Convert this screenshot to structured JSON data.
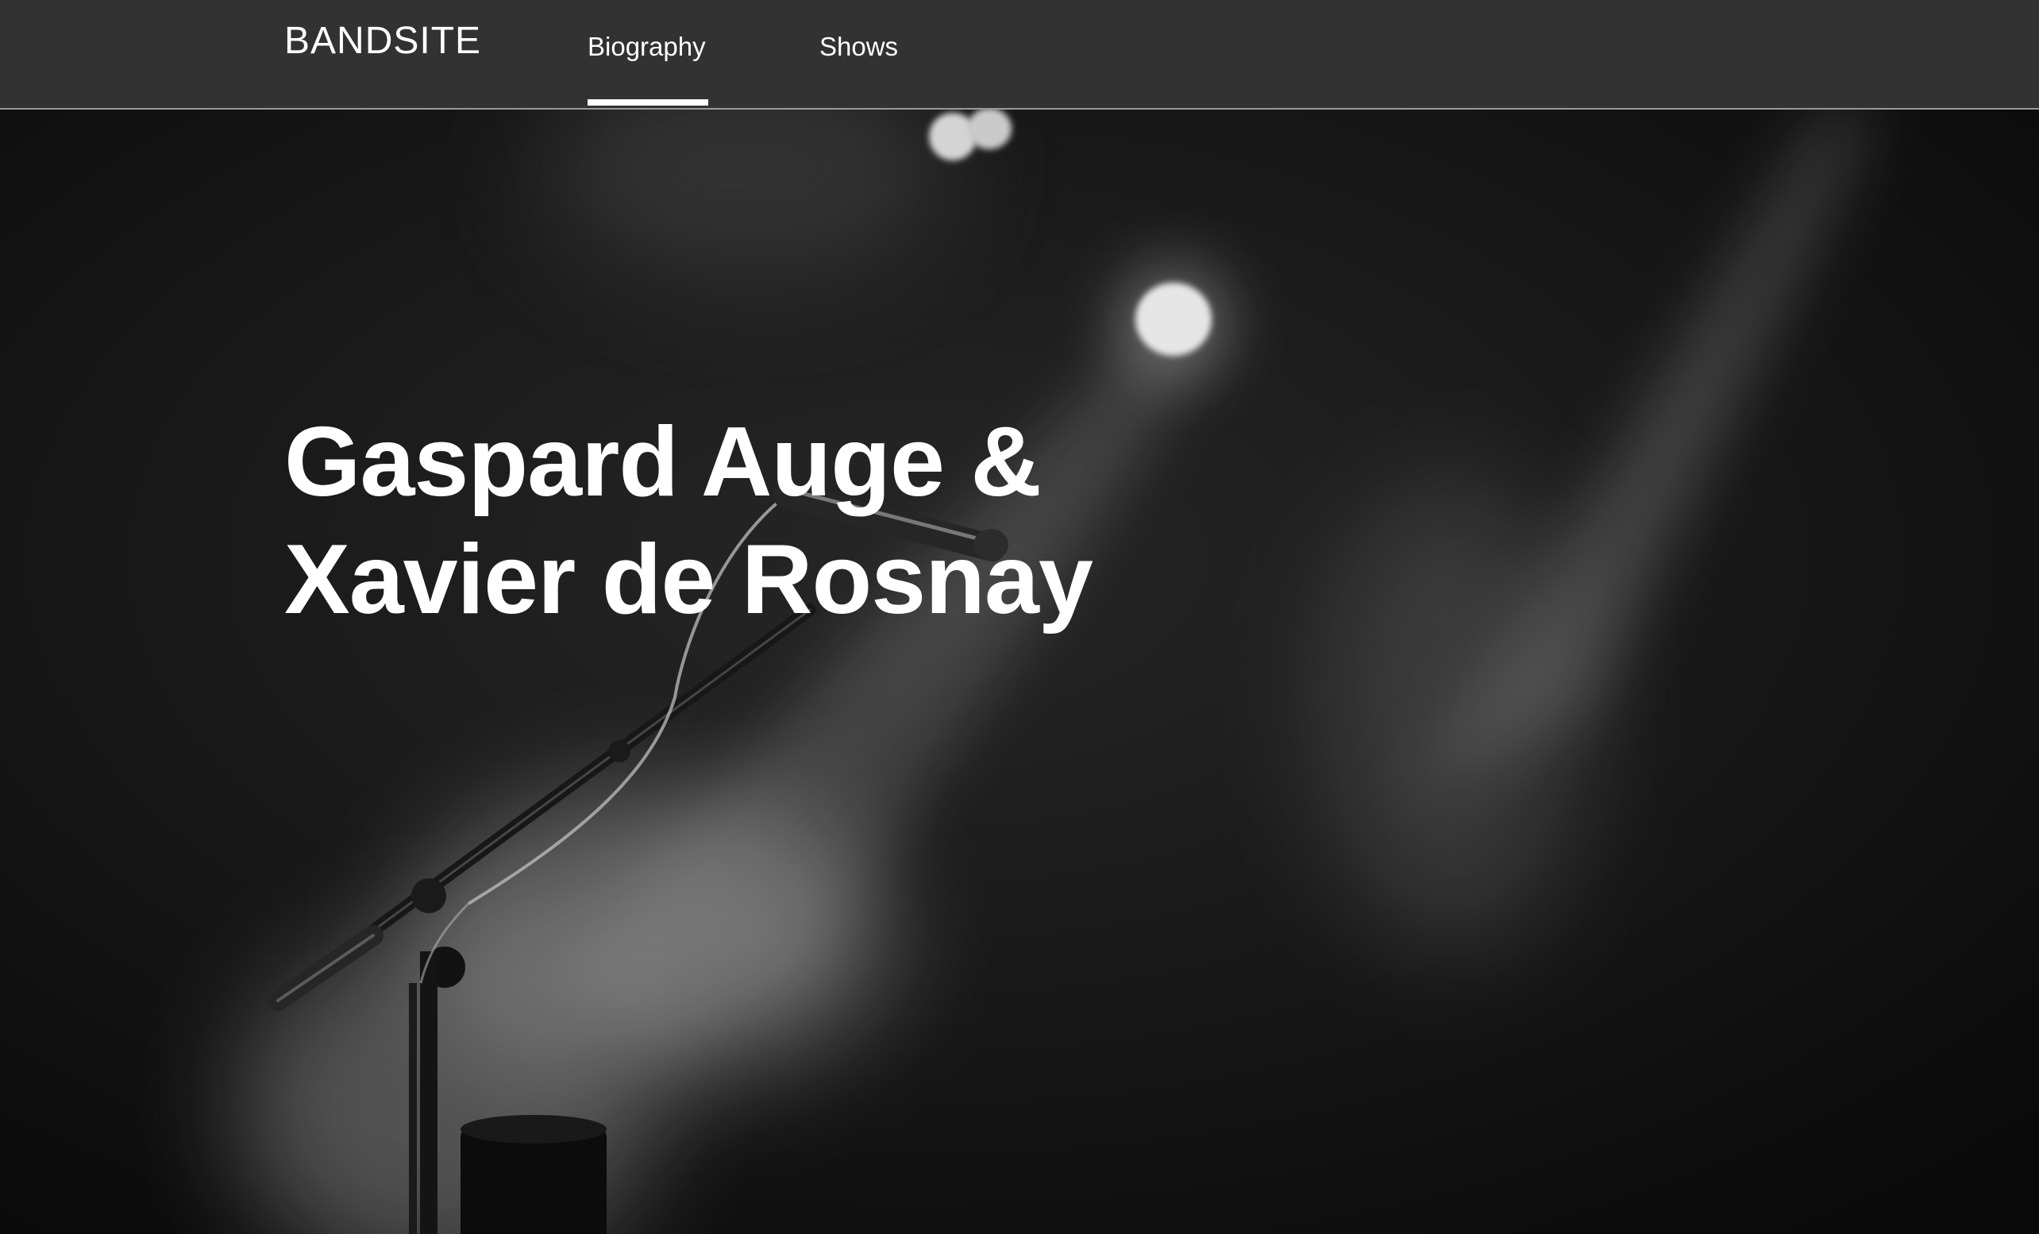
{
  "header": {
    "logo": "BANDSITE",
    "nav": [
      {
        "label": "Biography",
        "active": true
      },
      {
        "label": "Shows",
        "active": false
      }
    ]
  },
  "hero": {
    "title_line1": "Gaspard Auge &",
    "title_line2": "Xavier de Rosnay",
    "background": "black-and-white concert photo of a microphone on a stand under stage spotlights"
  },
  "colors": {
    "header_bg": "#323232",
    "header_border": "#9a9a9a",
    "text": "#ffffff",
    "hero_bg": "#141414"
  }
}
